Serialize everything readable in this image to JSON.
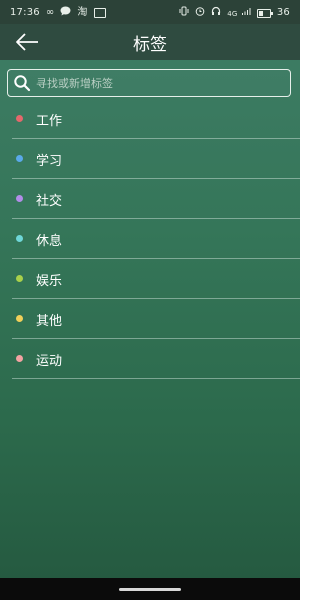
{
  "status_bar": {
    "time": "17:36",
    "left_icons": [
      "infinity-icon",
      "chat-bubble-icon",
      "taobao-icon",
      "mail-icon"
    ],
    "taobao_label": "淘",
    "network_label": "4G",
    "battery_level": "36",
    "right_icons": [
      "vibrate-icon",
      "alarm-icon",
      "headset-icon",
      "signal-icon",
      "battery-icon"
    ]
  },
  "header": {
    "title": "标签",
    "back_icon": "back-arrow-icon"
  },
  "search": {
    "placeholder": "寻找或新增标签",
    "value": "",
    "icon": "search-icon"
  },
  "tags": [
    {
      "label": "工作",
      "color": "#e4686c"
    },
    {
      "label": "学习",
      "color": "#5aa9ea"
    },
    {
      "label": "社交",
      "color": "#b28de8"
    },
    {
      "label": "休息",
      "color": "#6fd7d8"
    },
    {
      "label": "娱乐",
      "color": "#a9d04b"
    },
    {
      "label": "其他",
      "color": "#f0cf5a"
    },
    {
      "label": "运动",
      "color": "#f3a3a3"
    }
  ],
  "theme": {
    "background_top": "#3f7d66",
    "background_bottom": "#24583f",
    "header_bg": "#2f4b40"
  }
}
